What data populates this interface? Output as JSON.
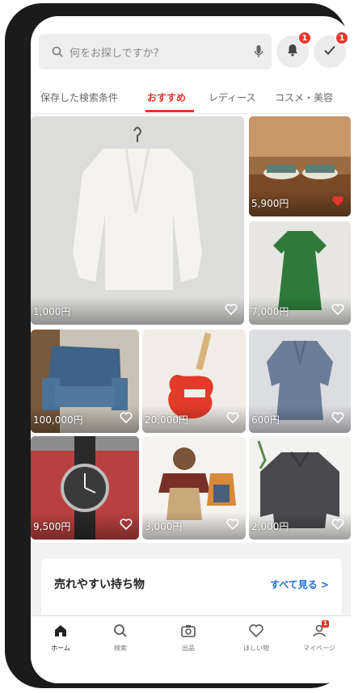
{
  "search": {
    "placeholder": "何をお探しですか?"
  },
  "notifications": {
    "bell_count": "1",
    "todo_count": "1"
  },
  "tabs": [
    {
      "label": "保存した検索条件"
    },
    {
      "label": "おすすめ"
    },
    {
      "label": "レディース"
    },
    {
      "label": "コスメ・美容"
    }
  ],
  "items": [
    {
      "name": "white-cardigan",
      "price": "1,000円",
      "liked": false
    },
    {
      "name": "teacups",
      "price": "5,900円",
      "liked": true
    },
    {
      "name": "green-dress",
      "price": "7,000円",
      "liked": false
    },
    {
      "name": "blue-armchair",
      "price": "100,000円",
      "liked": false
    },
    {
      "name": "red-guitar",
      "price": "20,000円",
      "liked": false
    },
    {
      "name": "blue-blouse",
      "price": "600円",
      "liked": false
    },
    {
      "name": "wristwatch",
      "price": "9,500円",
      "liked": false
    },
    {
      "name": "kids-clothes",
      "price": "3,000円",
      "liked": false
    },
    {
      "name": "dotted-blouse",
      "price": "2,000円",
      "liked": false
    }
  ],
  "section": {
    "title": "売れやすい持ち物",
    "link": "すべて見る >"
  },
  "bottom_nav": [
    {
      "label": "ホーム",
      "icon": "home-icon"
    },
    {
      "label": "検索",
      "icon": "search-icon"
    },
    {
      "label": "出品",
      "icon": "camera-icon"
    },
    {
      "label": "ほしい物",
      "icon": "heart-icon"
    },
    {
      "label": "マイページ",
      "icon": "person-icon",
      "badge": "1"
    }
  ],
  "colors": {
    "accent": "#ea352d",
    "link": "#1f6fd6"
  }
}
